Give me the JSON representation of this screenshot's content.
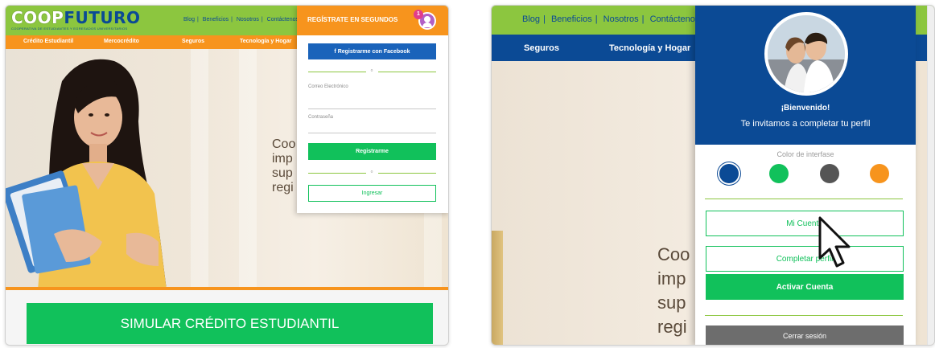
{
  "left": {
    "logo": {
      "coop": "COOP",
      "futuro": "FUTURO",
      "tagline": "COOPERATIVA DE ESTUDIANTES Y EGRESADOS UNIVERSITARIOS"
    },
    "top_links": [
      "Blog",
      "Beneficios",
      "Nosotros",
      "Contáctenos"
    ],
    "nav": [
      "Crédito Estudiantil",
      "Mercocrédito",
      "Seguros",
      "Tecnología y Hogar"
    ],
    "hero_lines": [
      "Coo",
      "imp",
      "sup",
      "regi"
    ],
    "register_panel": {
      "title": "REGÍSTRATE EN SEGUNDOS",
      "badge": "1",
      "facebook_button": "f  Registrarme con Facebook",
      "or": "o",
      "email_label": "Correo Electrónico",
      "password_label": "Contraseña",
      "register_button": "Registrarme",
      "login_button": "Ingresar"
    },
    "simulate_button": "SIMULAR CRÉDITO ESTUDIANTIL"
  },
  "right": {
    "top_links": [
      "Blog",
      "Beneficios",
      "Nosotros",
      "Contáctenos"
    ],
    "nav": [
      "Seguros",
      "Tecnología y Hogar"
    ],
    "hero_lines": [
      "Coo",
      "imp",
      "sup",
      "regi"
    ],
    "profile_panel": {
      "welcome": "¡Bienvenido!",
      "invite": "Te invitamos a completar tu perfil",
      "color_label": "Color de interfase",
      "colors": [
        "#0b4a95",
        "#11c15b",
        "#555555",
        "#f7941d"
      ],
      "my_account_button": "Mi Cuenta",
      "complete_profile_button": "Completar perfil",
      "activate_button": "Activar Cuenta",
      "logout_button": "Cerrar sesión"
    }
  },
  "colors": {
    "green": "#8cc63f",
    "orange": "#f7941d",
    "blue": "#0b4a95",
    "cta_green": "#11c15b"
  }
}
